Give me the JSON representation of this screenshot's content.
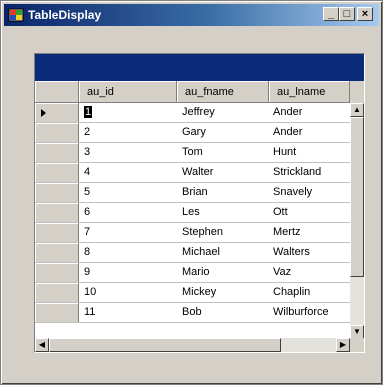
{
  "window": {
    "title": "TableDisplay",
    "buttons": {
      "minimize": "_",
      "maximize": "□",
      "close": "×"
    }
  },
  "grid": {
    "columns": [
      "au_id",
      "au_fname",
      "au_lname"
    ],
    "rows": [
      {
        "au_id": "1",
        "au_fname": "Jeffrey",
        "au_lname": "Ander"
      },
      {
        "au_id": "2",
        "au_fname": "Gary",
        "au_lname": "Ander"
      },
      {
        "au_id": "3",
        "au_fname": "Tom",
        "au_lname": "Hunt"
      },
      {
        "au_id": "4",
        "au_fname": "Walter",
        "au_lname": "Strickland"
      },
      {
        "au_id": "5",
        "au_fname": "Brian",
        "au_lname": "Snavely"
      },
      {
        "au_id": "6",
        "au_fname": "Les",
        "au_lname": "Ott"
      },
      {
        "au_id": "7",
        "au_fname": "Stephen",
        "au_lname": "Mertz"
      },
      {
        "au_id": "8",
        "au_fname": "Michael",
        "au_lname": "Walters"
      },
      {
        "au_id": "9",
        "au_fname": "Mario",
        "au_lname": "Vaz"
      },
      {
        "au_id": "10",
        "au_fname": "Mickey",
        "au_lname": "Chaplin"
      },
      {
        "au_id": "11",
        "au_fname": "Bob",
        "au_lname": "Wilburforce"
      }
    ],
    "scroll": {
      "up": "▲",
      "down": "▼",
      "left": "◀",
      "right": "▶"
    }
  }
}
